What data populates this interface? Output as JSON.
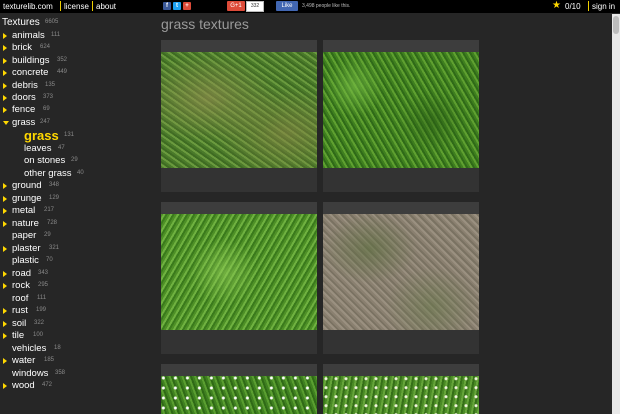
{
  "topbar": {
    "site": "texturelib.com",
    "license": "license",
    "about": "about",
    "gplus_label": "G+1",
    "gplus_count": "332",
    "fb_like": "Like",
    "fb_text": "3,498 people like this.",
    "counter": "0/10",
    "signin": "sign in",
    "icons": [
      "facebook-icon",
      "twitter-icon",
      "google-plus-icon",
      "star-icon"
    ],
    "accent": "#ffd800"
  },
  "sidebar": {
    "root": {
      "label": "Textures",
      "count": "6605"
    },
    "items": [
      {
        "label": "animals",
        "count": "111"
      },
      {
        "label": "brick",
        "count": "624"
      },
      {
        "label": "buildings",
        "count": "352"
      },
      {
        "label": "concrete",
        "count": "449"
      },
      {
        "label": "debris",
        "count": "135"
      },
      {
        "label": "doors",
        "count": "373"
      },
      {
        "label": "fence",
        "count": "69"
      },
      {
        "label": "grass",
        "count": "247"
      },
      {
        "label": "grass",
        "count": "131"
      },
      {
        "label": "leaves",
        "count": "47"
      },
      {
        "label": "on stones",
        "count": "29"
      },
      {
        "label": "other grass",
        "count": "40"
      },
      {
        "label": "ground",
        "count": "348"
      },
      {
        "label": "grunge",
        "count": "129"
      },
      {
        "label": "metal",
        "count": "217"
      },
      {
        "label": "nature",
        "count": "728"
      },
      {
        "label": "paper",
        "count": "29"
      },
      {
        "label": "plaster",
        "count": "321"
      },
      {
        "label": "plastic",
        "count": "70"
      },
      {
        "label": "road",
        "count": "343"
      },
      {
        "label": "rock",
        "count": "295"
      },
      {
        "label": "roof",
        "count": "111"
      },
      {
        "label": "rust",
        "count": "199"
      },
      {
        "label": "soil",
        "count": "322"
      },
      {
        "label": "tile",
        "count": "100"
      },
      {
        "label": "vehicles",
        "count": "18"
      },
      {
        "label": "water",
        "count": "185"
      },
      {
        "label": "windows",
        "count": "358"
      },
      {
        "label": "wood",
        "count": "472"
      }
    ]
  },
  "main": {
    "title": "grass textures"
  }
}
